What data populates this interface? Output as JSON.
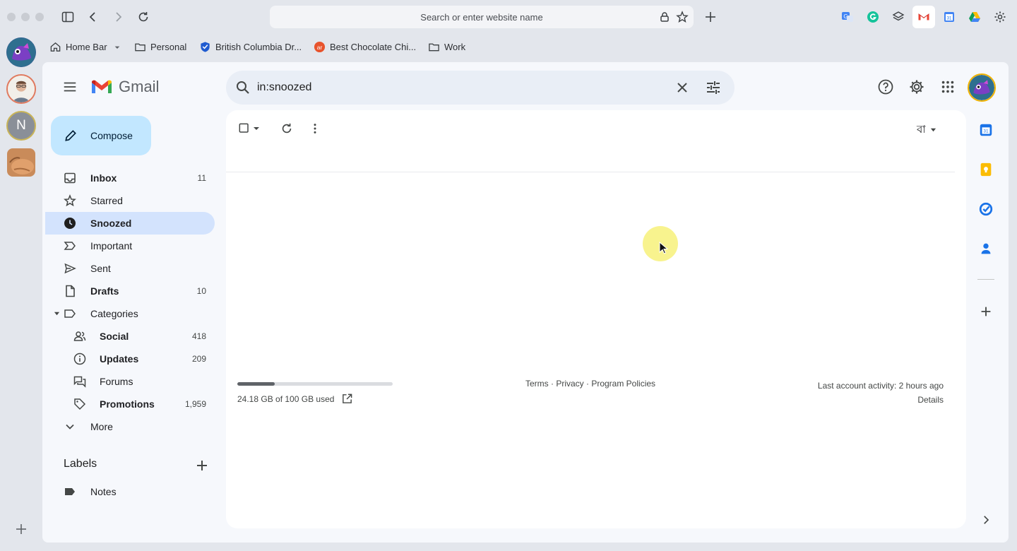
{
  "browser": {
    "address_placeholder": "Search or enter website name",
    "bookmarks": [
      {
        "label": "Home Bar",
        "icon": "home-icon",
        "has_menu": true
      },
      {
        "label": "Personal",
        "icon": "folder-icon"
      },
      {
        "label": "British Columbia Dr...",
        "icon": "shield-logo-icon"
      },
      {
        "label": "Best Chocolate Chi...",
        "icon": "recipe-logo-icon"
      },
      {
        "label": "Work",
        "icon": "folder-icon"
      }
    ],
    "profile_initial": "N"
  },
  "gmail": {
    "app_name": "Gmail",
    "search_query": "in:snoozed",
    "compose_label": "Compose",
    "nav": [
      {
        "label": "Inbox",
        "count": "11",
        "bold": true,
        "icon": "inbox-icon"
      },
      {
        "label": "Starred",
        "count": "",
        "icon": "star-icon"
      },
      {
        "label": "Snoozed",
        "count": "",
        "bold": true,
        "active": true,
        "icon": "clock-icon"
      },
      {
        "label": "Important",
        "count": "",
        "icon": "important-icon"
      },
      {
        "label": "Sent",
        "count": "",
        "icon": "send-icon"
      },
      {
        "label": "Drafts",
        "count": "10",
        "bold": true,
        "icon": "draft-icon"
      },
      {
        "label": "Categories",
        "count": "",
        "icon": "label-icon"
      },
      {
        "label": "Social",
        "count": "418",
        "bold": true,
        "icon": "people-icon"
      },
      {
        "label": "Updates",
        "count": "209",
        "bold": true,
        "icon": "info-icon"
      },
      {
        "label": "Forums",
        "count": "",
        "icon": "forum-icon"
      },
      {
        "label": "Promotions",
        "count": "1,959",
        "bold": true,
        "icon": "tag-icon"
      },
      {
        "label": "More",
        "count": "",
        "icon": "chevron-down-icon"
      }
    ],
    "labels_heading": "Labels",
    "labels": [
      {
        "label": "Notes",
        "icon": "label-filled-icon"
      }
    ],
    "input_tools_label": "বা",
    "storage": {
      "text": "24.18 GB of 100 GB used",
      "used_fraction": 0.2418
    },
    "footer_links": "Terms · Privacy · Program Policies",
    "last_activity": "Last account activity: 2 hours ago",
    "details_link": "Details"
  },
  "colors": {
    "accent": "#0b57d0",
    "compose_bg": "#c2e7ff",
    "active_nav_bg": "#d3e3fd",
    "search_bg": "#e9eef6"
  }
}
